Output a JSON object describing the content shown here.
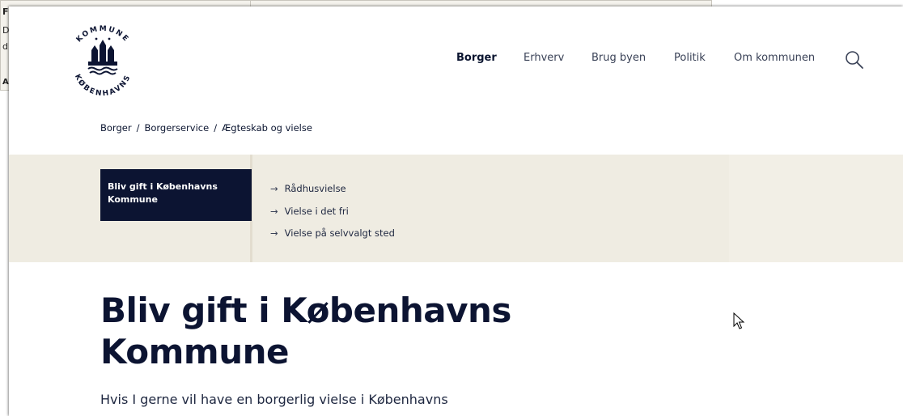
{
  "background_window": {
    "line1": "Fl",
    "line2": "D",
    "line3": "d",
    "line4": "A"
  },
  "header": {
    "logo_text": "KØBENHAVNS KOMMUNE",
    "nav": [
      {
        "label": "Borger",
        "active": true
      },
      {
        "label": "Erhverv",
        "active": false
      },
      {
        "label": "Brug byen",
        "active": false
      },
      {
        "label": "Politik",
        "active": false
      },
      {
        "label": "Om kommunen",
        "active": false
      }
    ],
    "search_icon": "search-icon"
  },
  "breadcrumb": [
    "Borger",
    "Borgerservice",
    "Ægteskab og vielse"
  ],
  "breadcrumb_separator": "/",
  "subnav": {
    "active": "Bliv gift i Københavns Kommune",
    "links": [
      "Rådhusvielse",
      "Vielse i det fri",
      "Vielse på selvvalgt sted"
    ],
    "arrow": "→"
  },
  "main": {
    "title_line1": "Bliv gift i Københavns",
    "title_line2": "Kommune",
    "intro": "Hvis I gerne vil have en borgerlig vielse i Københavns"
  },
  "colors": {
    "navy": "#0c1432",
    "band": "#efece2",
    "text": "#1e2740"
  }
}
